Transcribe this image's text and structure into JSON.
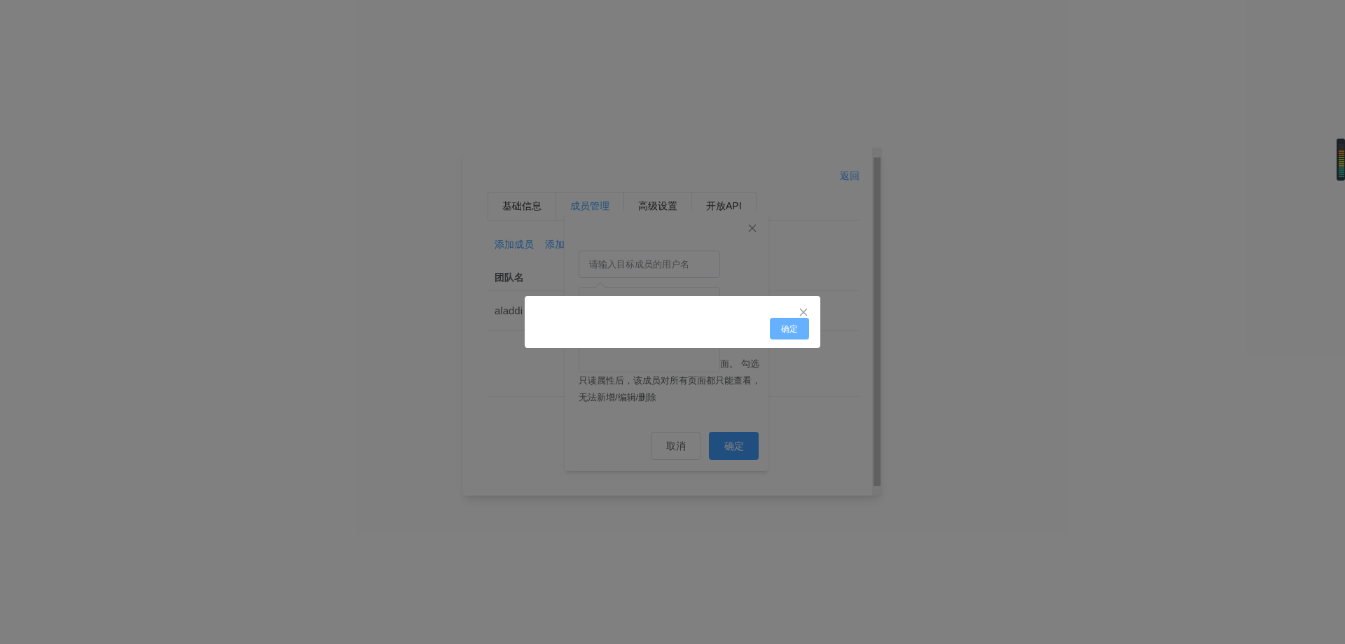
{
  "page": {
    "back_link": "返回",
    "tabs": [
      {
        "label": "基础信息",
        "selected": false
      },
      {
        "label": "成员管理",
        "selected": true
      },
      {
        "label": "高级设置",
        "selected": false
      },
      {
        "label": "开放API",
        "selected": false
      }
    ],
    "actions": [
      "添加成员",
      "添加"
    ],
    "table": {
      "columns": [
        "团队名"
      ],
      "rows": [
        [
          "aladdi"
        ]
      ]
    }
  },
  "member_dialog": {
    "username_placeholder": "请输入目标成员的用户名",
    "note_lines": [
      "面。 勾选",
      "只读属性后，该成员对所有页面都只能查看，",
      "无法新增/编辑/删除"
    ],
    "buttons": [
      {
        "label": "取消",
        "kind": "default"
      },
      {
        "label": "确定",
        "kind": "primary"
      }
    ]
  },
  "confirm_dialog": {
    "button": "确定"
  }
}
